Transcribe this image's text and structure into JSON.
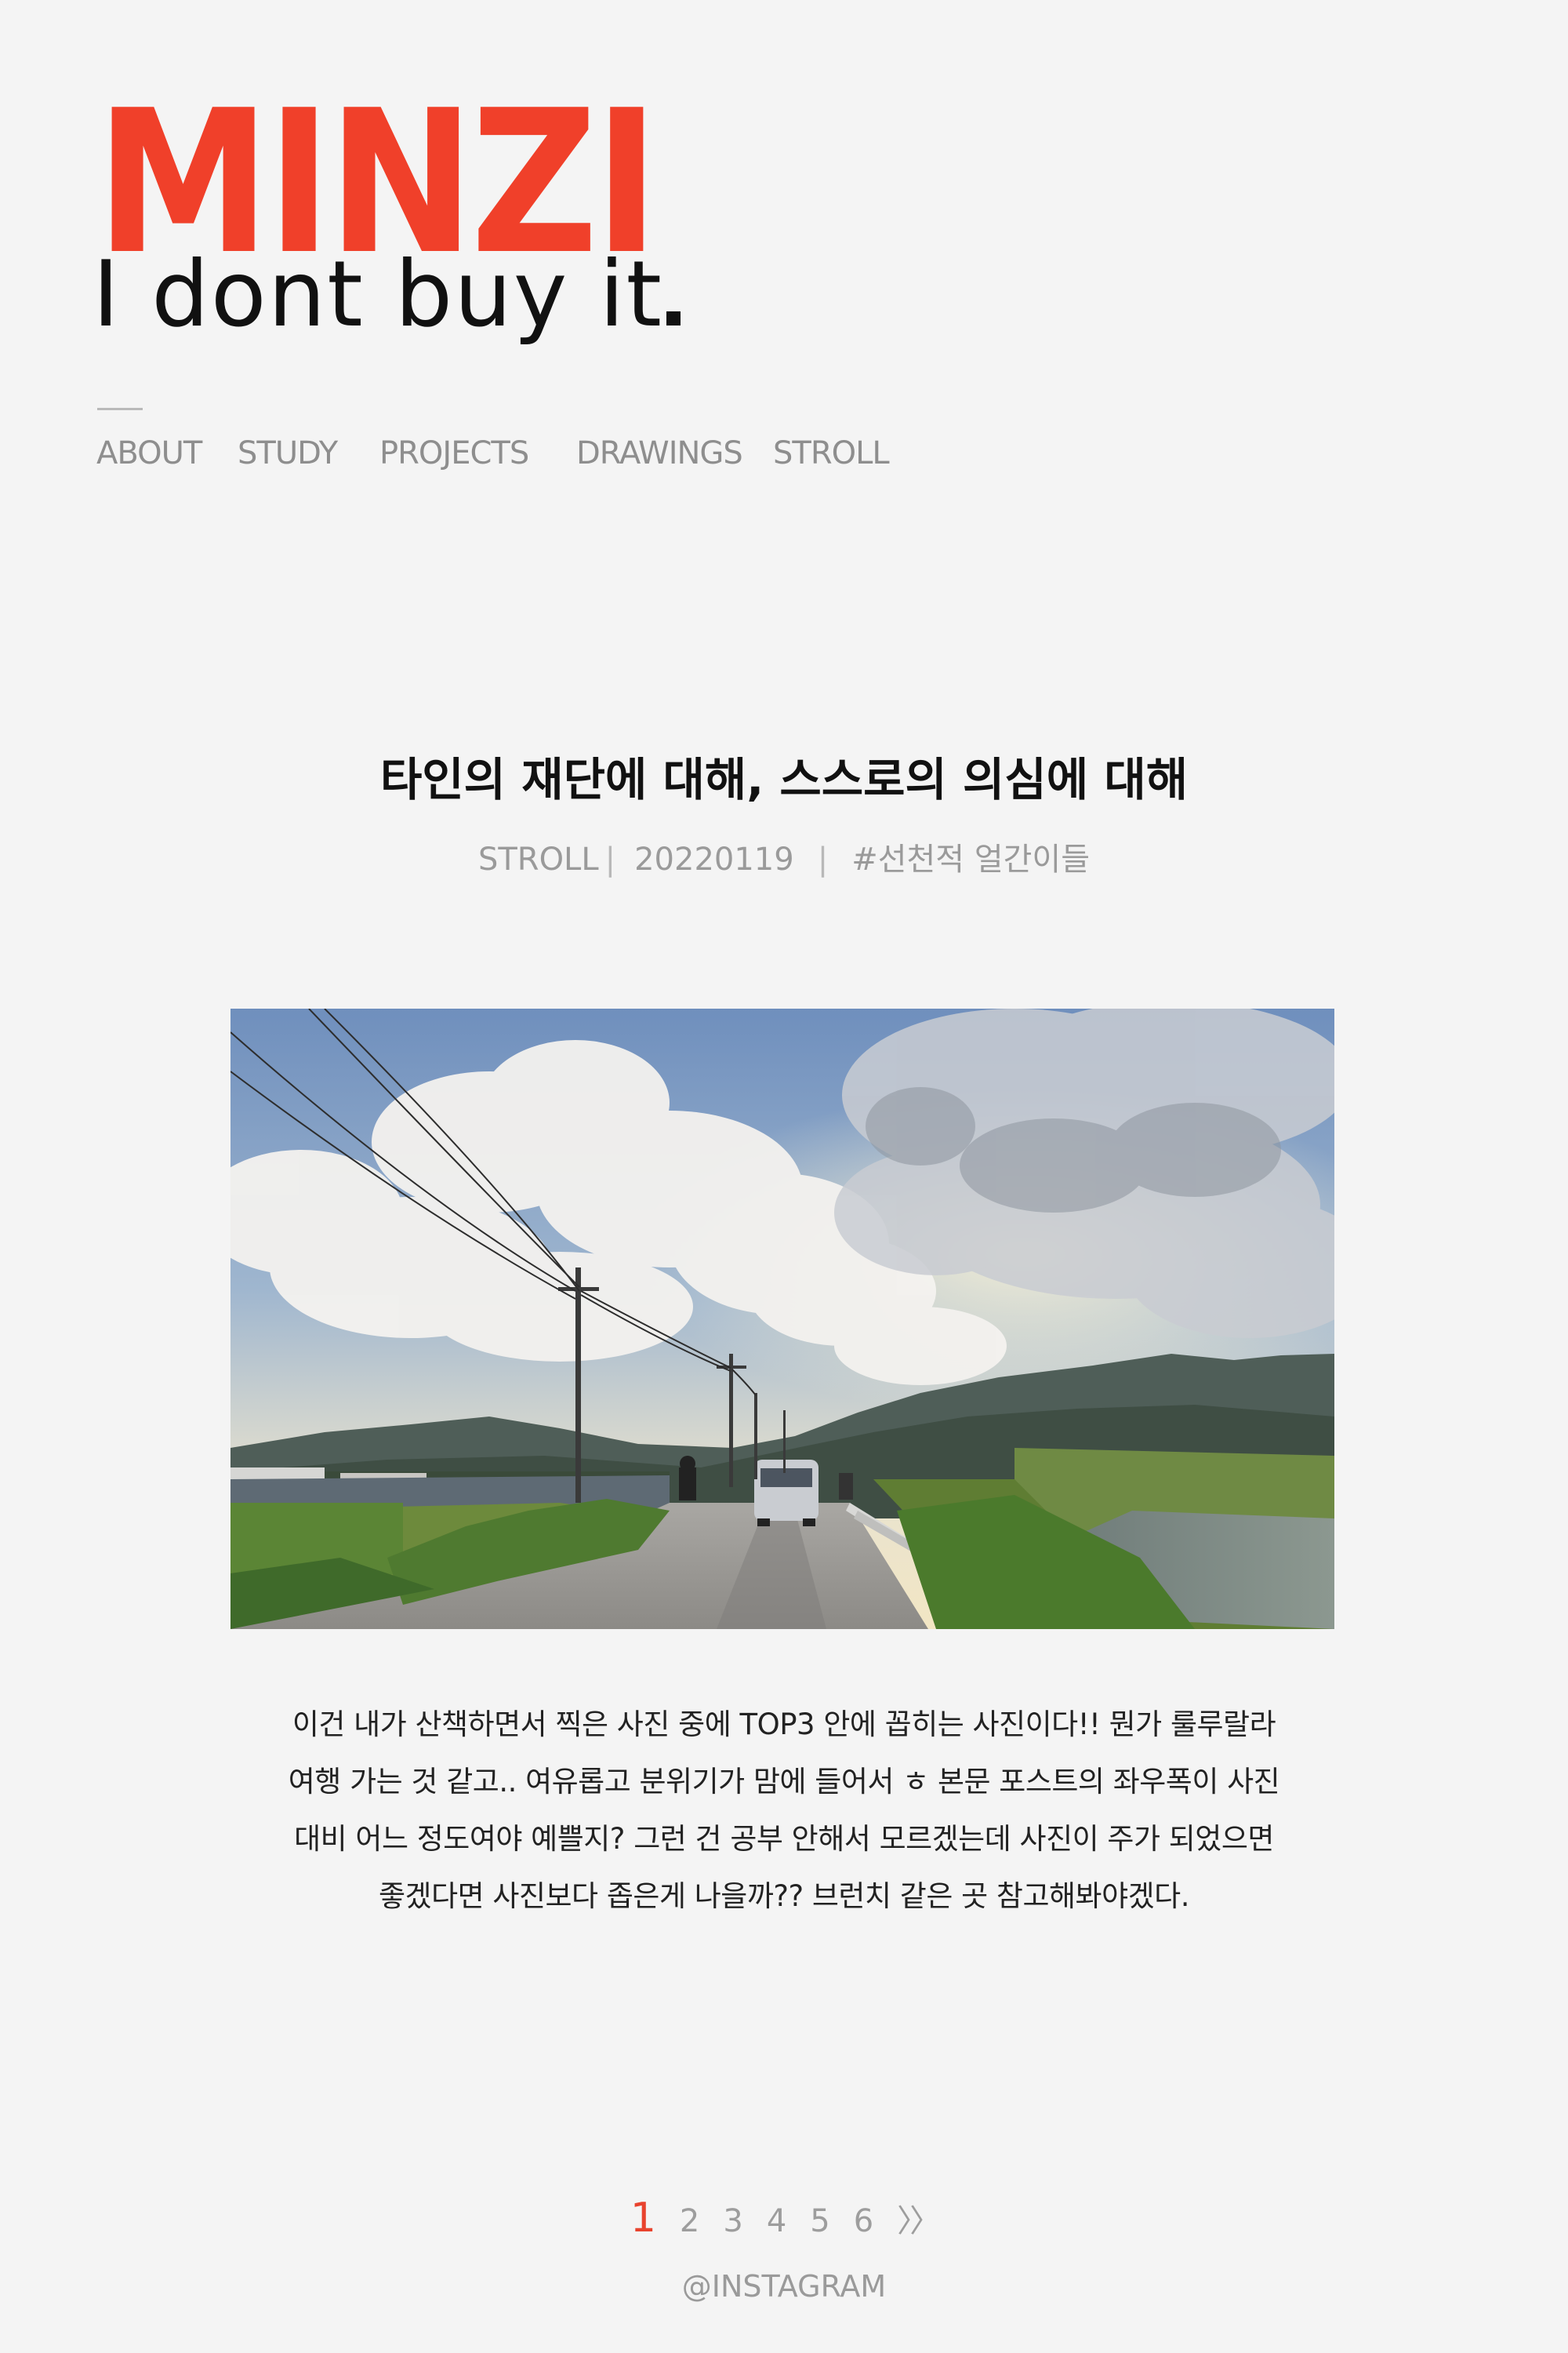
{
  "site": {
    "logo": "MINZI",
    "tagline": "I dont buy it",
    "accent_color": "#f0402a"
  },
  "nav": {
    "items": [
      {
        "label": "ABOUT"
      },
      {
        "label": "STUDY"
      },
      {
        "label": "PROJECTS"
      },
      {
        "label": "DRAWINGS"
      },
      {
        "label": "STROLL"
      }
    ]
  },
  "post": {
    "title": "타인의 재단에 대해, 스스로의 의심에 대해",
    "category": "STROLL",
    "date": "20220119",
    "tag": "#선천적 얼간이들",
    "image_description_icon": "landscape-photo",
    "body_lines": [
      "이건 내가 산책하면서 찍은 사진 중에 TOP3 안에 꼽히는 사진이다!! 뭔가 룰루랄라",
      "여행 가는 것 같고.. 여유롭고 분위기가 맘에 들어서 ㅎ 본문 포스트의 좌우폭이 사진",
      "대비 어느 정도여야 예쁠지? 그런 건 공부 안해서 모르겠는데 사진이 주가 되었으면",
      "좋겠다면 사진보다 좁은게 나을까?? 브런치 같은 곳 참고해봐야겠다."
    ]
  },
  "pagination": {
    "pages": [
      "1",
      "2",
      "3",
      "4",
      "5",
      "6"
    ],
    "current": "1",
    "next_label": "〉〉"
  },
  "footer": {
    "instagram_label": "@INSTAGRAM"
  }
}
